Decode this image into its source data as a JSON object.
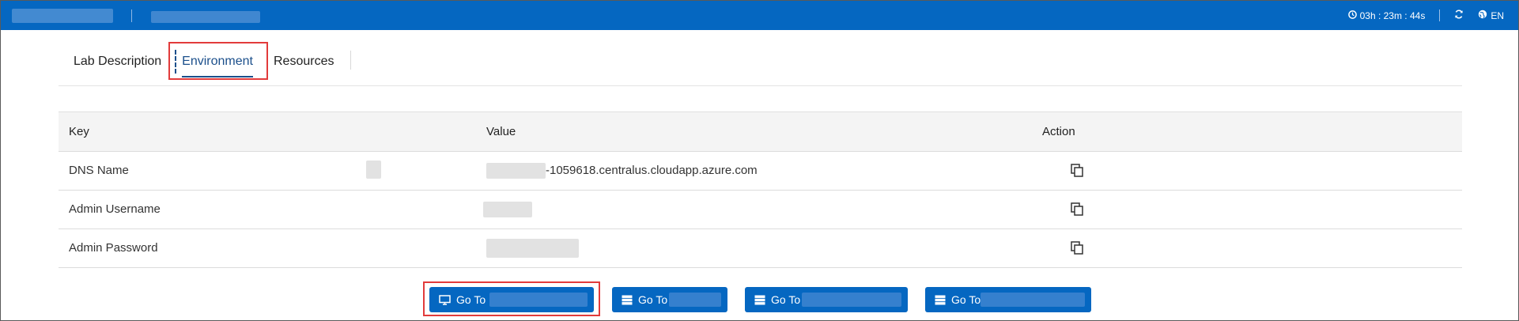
{
  "topbar": {
    "timer": "03h : 23m : 44s",
    "language": "EN",
    "timer_icon": "clock-icon",
    "refresh_icon": "refresh-icon",
    "globe_icon": "globe-icon"
  },
  "tabs": [
    {
      "label": "Lab Description"
    },
    {
      "label": "Environment"
    },
    {
      "label": "Resources"
    }
  ],
  "table": {
    "headers": {
      "key": "Key",
      "value": "Value",
      "action": "Action"
    },
    "rows": [
      {
        "key": "DNS Name",
        "value": "-1059618.centralus.cloudapp.azure.com"
      },
      {
        "key": "Admin Username",
        "value": ""
      },
      {
        "key": "Admin Password",
        "value": ""
      }
    ]
  },
  "buttons": [
    {
      "label": "Go To",
      "icon": "monitor-icon"
    },
    {
      "label": "Go To",
      "icon": "server-icon"
    },
    {
      "label": "Go To",
      "icon": "server-icon"
    },
    {
      "label": "Go To",
      "icon": "server-icon"
    }
  ],
  "colors": {
    "primary": "#0567c1",
    "active_tab": "#1b4f8b",
    "highlight": "#e23b3b"
  }
}
